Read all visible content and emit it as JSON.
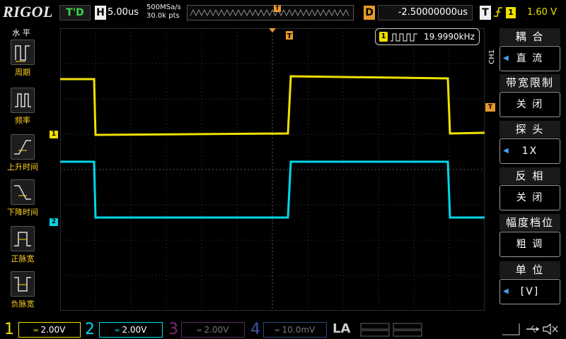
{
  "brand": "RIGOL",
  "status": "T'D",
  "horizontal": {
    "label": "H",
    "scale": "5.00us",
    "sample_rate": "500MSa/s",
    "memory": "30.0k pts"
  },
  "trigger_marker": "T",
  "delay": {
    "label": "D",
    "value": "-2.50000000us"
  },
  "trigger": {
    "label": "T",
    "edge": "rising-edge-icon",
    "source": "1",
    "level": "1.60 V"
  },
  "left_menu": {
    "title": "水 平",
    "items": [
      {
        "label": "周期",
        "icon": "period-icon"
      },
      {
        "label": "频率",
        "icon": "frequency-icon"
      },
      {
        "label": "上升时间",
        "icon": "rise-time-icon"
      },
      {
        "label": "下降时间",
        "icon": "fall-time-icon"
      },
      {
        "label": "正脉宽",
        "icon": "positive-width-icon"
      },
      {
        "label": "负脉宽",
        "icon": "negative-width-icon"
      }
    ]
  },
  "measurement": {
    "channel": "1",
    "value": "19.9990kHz"
  },
  "right_menu": {
    "channel_tag": "CH1",
    "items": [
      {
        "label": "耦 合",
        "value": "直 流",
        "has_arrow": true
      },
      {
        "label": "带宽限制",
        "value": "关 闭",
        "has_arrow": false
      },
      {
        "label": "探 头",
        "value": "1X",
        "has_arrow": true
      },
      {
        "label": "反 相",
        "value": "关 闭",
        "has_arrow": false
      },
      {
        "label": "幅度档位",
        "value": "粗 调",
        "has_arrow": false
      },
      {
        "label": "单 位",
        "value": "[V]",
        "has_arrow": true
      }
    ]
  },
  "channels": [
    {
      "num": "1",
      "scale": "2.00V",
      "color": "#f0e000",
      "active": true
    },
    {
      "num": "2",
      "scale": "2.00V",
      "color": "#00d8e8",
      "active": true
    },
    {
      "num": "3",
      "scale": "2.00V",
      "color": "#c040c0",
      "active": false
    },
    {
      "num": "4",
      "scale": "10.0mV",
      "color": "#3a7ad8",
      "active": false
    }
  ],
  "la_label": "LA",
  "colors": {
    "ch1": "#f0e000",
    "ch2": "#00d8e8",
    "trigger": "#e79a2a",
    "accent": "#37d64a"
  }
}
